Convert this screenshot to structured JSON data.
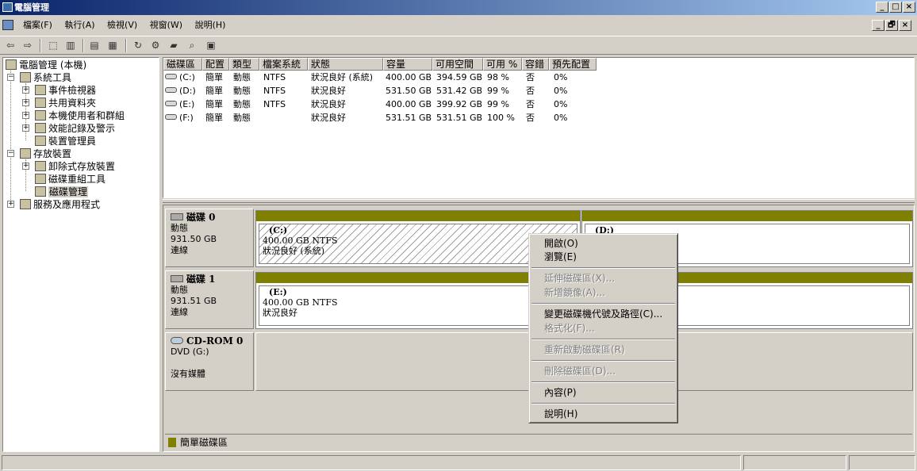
{
  "window": {
    "title": "電腦管理",
    "min": "_",
    "max": "□",
    "close": "×"
  },
  "menu": {
    "items": [
      "檔案(F)",
      "執行(A)",
      "檢視(V)",
      "視窗(W)",
      "說明(H)"
    ],
    "mdi": [
      "_",
      "🗗",
      "×"
    ]
  },
  "toolbar": {
    "icons": [
      "back-arrow-icon",
      "forward-arrow-icon",
      "up-folder-icon",
      "show-tree-icon",
      "properties-icon",
      "help-icon",
      "refresh-icon",
      "settings-icon",
      "open-icon",
      "search-icon",
      "toolbar-extra-icon"
    ]
  },
  "tree": {
    "items": [
      {
        "label": "電腦管理 (本機)"
      },
      {
        "label": "系統工具"
      },
      {
        "label": "事件檢視器"
      },
      {
        "label": "共用資料夾"
      },
      {
        "label": "本機使用者和群組"
      },
      {
        "label": "效能記錄及警示"
      },
      {
        "label": "裝置管理員"
      },
      {
        "label": "存放裝置"
      },
      {
        "label": "卸除式存放裝置"
      },
      {
        "label": "磁碟重組工具"
      },
      {
        "label": "磁碟管理"
      },
      {
        "label": "服務及應用程式"
      }
    ]
  },
  "volumes": {
    "headers": [
      "磁碟區",
      "配置",
      "類型",
      "檔案系統",
      "狀態",
      "容量",
      "可用空間",
      "可用 %",
      "容錯",
      "預先配置"
    ],
    "rows": [
      [
        "(C:)",
        "簡單",
        "動態",
        "NTFS",
        "狀況良好 (系統)",
        "400.00 GB",
        "394.59 GB",
        "98 %",
        "否",
        "0%"
      ],
      [
        "(D:)",
        "簡單",
        "動態",
        "NTFS",
        "狀況良好",
        "531.50 GB",
        "531.42 GB",
        "99 %",
        "否",
        "0%"
      ],
      [
        "(E:)",
        "簡單",
        "動態",
        "NTFS",
        "狀況良好",
        "400.00 GB",
        "399.92 GB",
        "99 %",
        "否",
        "0%"
      ],
      [
        "(F:)",
        "簡單",
        "動態",
        "",
        "狀況良好",
        "531.51 GB",
        "531.51 GB",
        "100 %",
        "否",
        "0%"
      ]
    ]
  },
  "disks": [
    {
      "name": "磁碟 0",
      "type": "動態",
      "size": "931.50 GB",
      "status": "連線",
      "parts": [
        {
          "name": "(C:)",
          "size": "400.00 GB NTFS",
          "status": "狀況良好 (系統)"
        },
        {
          "name": "(D:)",
          "size": "",
          "status": ""
        }
      ]
    },
    {
      "name": "磁碟 1",
      "type": "動態",
      "size": "931.51 GB",
      "status": "連線",
      "parts": [
        {
          "name": "(E:)",
          "size": "400.00 GB NTFS",
          "status": "狀況良好"
        }
      ]
    },
    {
      "name": "CD-ROM 0",
      "type": "DVD (G:)",
      "status": "沒有媒體"
    }
  ],
  "legend": {
    "label": "簡單磁碟區",
    "color": "#808000"
  },
  "context_menu": [
    {
      "label": "開啟(O)",
      "enabled": true
    },
    {
      "label": "瀏覽(E)",
      "enabled": true
    },
    {
      "label": "延伸磁碟區(X)...",
      "enabled": false
    },
    {
      "label": "新增鏡像(A)...",
      "enabled": false
    },
    {
      "label": "變更磁碟機代號及路徑(C)...",
      "enabled": true
    },
    {
      "label": "格式化(F)...",
      "enabled": false
    },
    {
      "label": "重新啟動磁碟區(R)",
      "enabled": false
    },
    {
      "label": "刪除磁碟區(D)...",
      "enabled": false
    },
    {
      "label": "內容(P)",
      "enabled": true
    },
    {
      "label": "說明(H)",
      "enabled": true
    }
  ]
}
